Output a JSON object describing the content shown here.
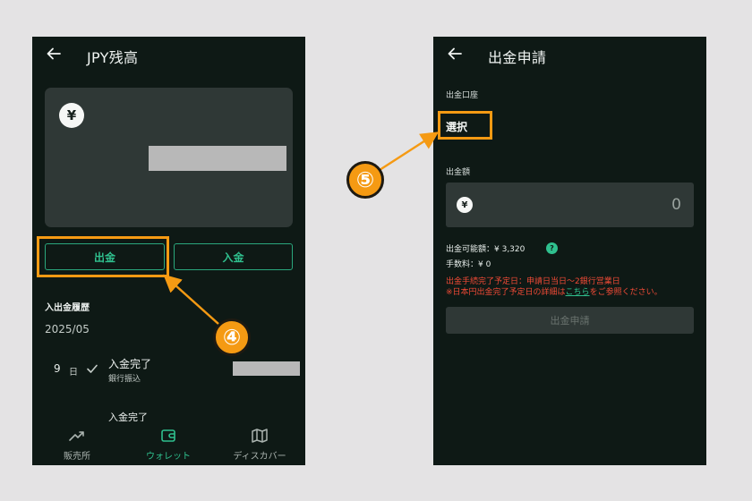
{
  "left_screen": {
    "header": {
      "title": "JPY残高"
    },
    "balance_card": {
      "currency_symbol": "¥"
    },
    "actions": {
      "withdraw_label": "出金",
      "deposit_label": "入金"
    },
    "history": {
      "title": "入出金履歴",
      "month": "2025/05",
      "items": [
        {
          "day": "9",
          "day_unit": "日",
          "title": "入金完了",
          "subtitle": "銀行振込"
        },
        {
          "title": "入金完了"
        }
      ]
    },
    "bottom_nav": [
      {
        "label": "販売所",
        "icon": "trending-up-icon"
      },
      {
        "label": "ウォレット",
        "icon": "wallet-icon",
        "active": true
      },
      {
        "label": "ディスカバー",
        "icon": "map-icon"
      }
    ]
  },
  "right_screen": {
    "header": {
      "title": "出金申請"
    },
    "account": {
      "label": "出金口座",
      "value": "選択"
    },
    "amount": {
      "label": "出金額",
      "currency_symbol": "¥",
      "value": "0"
    },
    "available": {
      "text": "出金可能額：¥ 3,320",
      "help": "?"
    },
    "fee": {
      "text": "手数料：¥ 0"
    },
    "notice": {
      "line1": "出金手続完了予定日：申請日当日〜2銀行営業日",
      "line2_prefix": "※日本円出金完了予定日の詳細は",
      "line2_link": "こちら",
      "line2_suffix": "をご参照ください。"
    },
    "submit_label": "出金申請"
  },
  "annotations": {
    "step4": "④",
    "step5": "⑤"
  },
  "colors": {
    "accent": "#2fc08e",
    "highlight": "#f59a13",
    "warning": "#f04a36",
    "background": "#0e1915"
  }
}
